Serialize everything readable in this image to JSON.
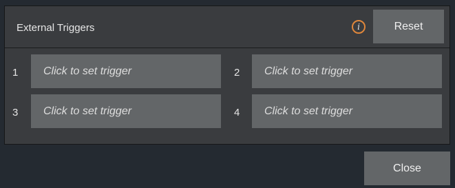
{
  "header": {
    "title": "External Triggers",
    "info_icon": "i",
    "reset_label": "Reset"
  },
  "triggers": [
    {
      "number": "1",
      "label": "Click to set trigger"
    },
    {
      "number": "2",
      "label": "Click to set trigger"
    },
    {
      "number": "3",
      "label": "Click to set trigger"
    },
    {
      "number": "4",
      "label": "Click to set trigger"
    }
  ],
  "footer": {
    "close_label": "Close"
  },
  "colors": {
    "background": "#242a31",
    "panel": "#3a3c3f",
    "button": "#636668",
    "info_accent": "#e0873b"
  }
}
